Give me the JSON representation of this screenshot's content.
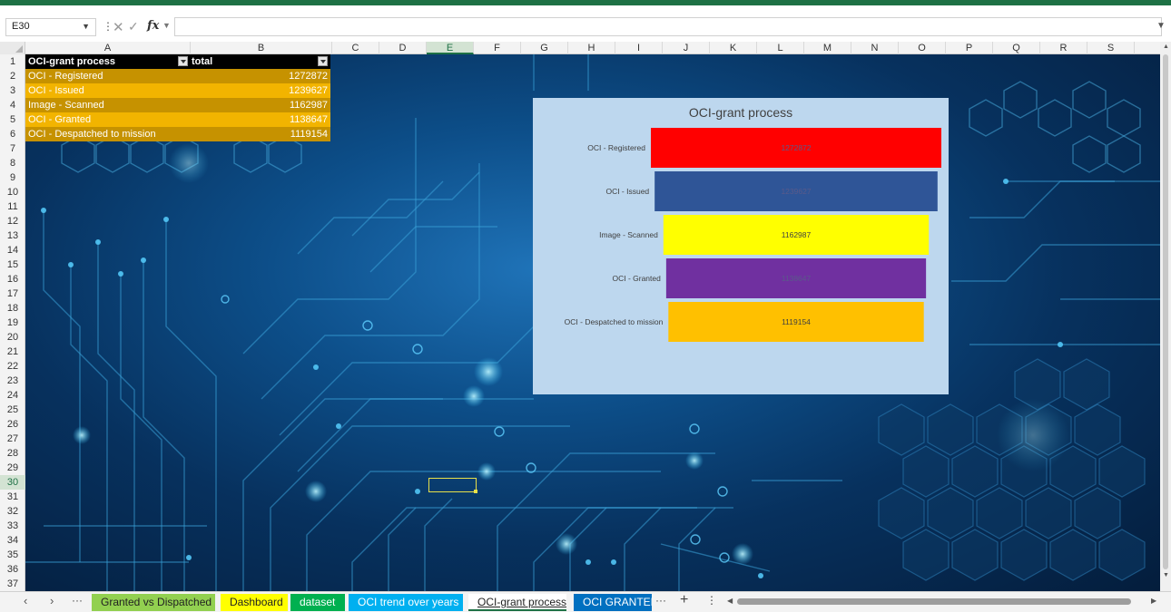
{
  "colors": {
    "accent": "#1e7145",
    "bar_colors": [
      "#ff0000",
      "#2f5597",
      "#ffff00",
      "#7030a0",
      "#ffc000"
    ],
    "chart_bg": "#bdd7ee"
  },
  "formula_bar": {
    "name_box": "E30",
    "formula": "",
    "fx_label": "fx",
    "cancel_icon": "x-icon",
    "confirm_icon": "check-icon"
  },
  "columns": [
    "A",
    "B",
    "C",
    "D",
    "E",
    "F",
    "G",
    "H",
    "I",
    "J",
    "K",
    "L",
    "M",
    "N",
    "O",
    "P",
    "Q",
    "R",
    "S"
  ],
  "selected_column": "E",
  "rows": [
    "1",
    "2",
    "3",
    "4",
    "5",
    "6",
    "7",
    "8",
    "9",
    "10",
    "11",
    "12",
    "13",
    "14",
    "15",
    "16",
    "17",
    "18",
    "19",
    "20",
    "21",
    "22",
    "23",
    "24",
    "25",
    "26",
    "27",
    "28",
    "29",
    "30",
    "31",
    "32",
    "33",
    "34",
    "35",
    "36",
    "37"
  ],
  "selected_row": "30",
  "pivot": {
    "header": {
      "label": "OCI-grant process",
      "value": "total"
    },
    "rows": [
      {
        "label": "OCI - Registered",
        "value": "1272872"
      },
      {
        "label": "OCI - Issued",
        "value": "1239627"
      },
      {
        "label": "Image - Scanned",
        "value": "1162987"
      },
      {
        "label": "OCI - Granted",
        "value": "1138647"
      },
      {
        "label": "OCI - Despatched to mission",
        "value": "1119154"
      }
    ]
  },
  "chart_data": {
    "type": "bar",
    "orientation": "horizontal-funnel",
    "title": "OCI-grant process",
    "categories": [
      "OCI - Registered",
      "OCI - Issued",
      "Image - Scanned",
      "OCI - Granted",
      "OCI - Despatched to mission"
    ],
    "values": [
      1272872,
      1239627,
      1162987,
      1138647,
      1119154
    ],
    "value_labels": [
      "1272872",
      "1239627",
      "1162987",
      "1138647",
      "1119154"
    ],
    "xlabel": "",
    "ylabel": "",
    "grid": false,
    "legend": "none"
  },
  "sheet_tabs": [
    {
      "label": "Granted vs Dispatched",
      "color": "#92d050"
    },
    {
      "label": "Dashboard",
      "color": "#ffff00"
    },
    {
      "label": "dataset",
      "color": "#00b050"
    },
    {
      "label": "OCI trend over years",
      "color": "#00b0f0"
    },
    {
      "label": "OCI-grant process",
      "color": "#ffffff",
      "active": true
    },
    {
      "label": "OCI GRANTEE",
      "color": "#0070c0"
    }
  ],
  "tab_controls": {
    "prev": "‹",
    "next": "›",
    "more_left": "···",
    "more_right": "···",
    "add": "+",
    "options": "⋮"
  }
}
